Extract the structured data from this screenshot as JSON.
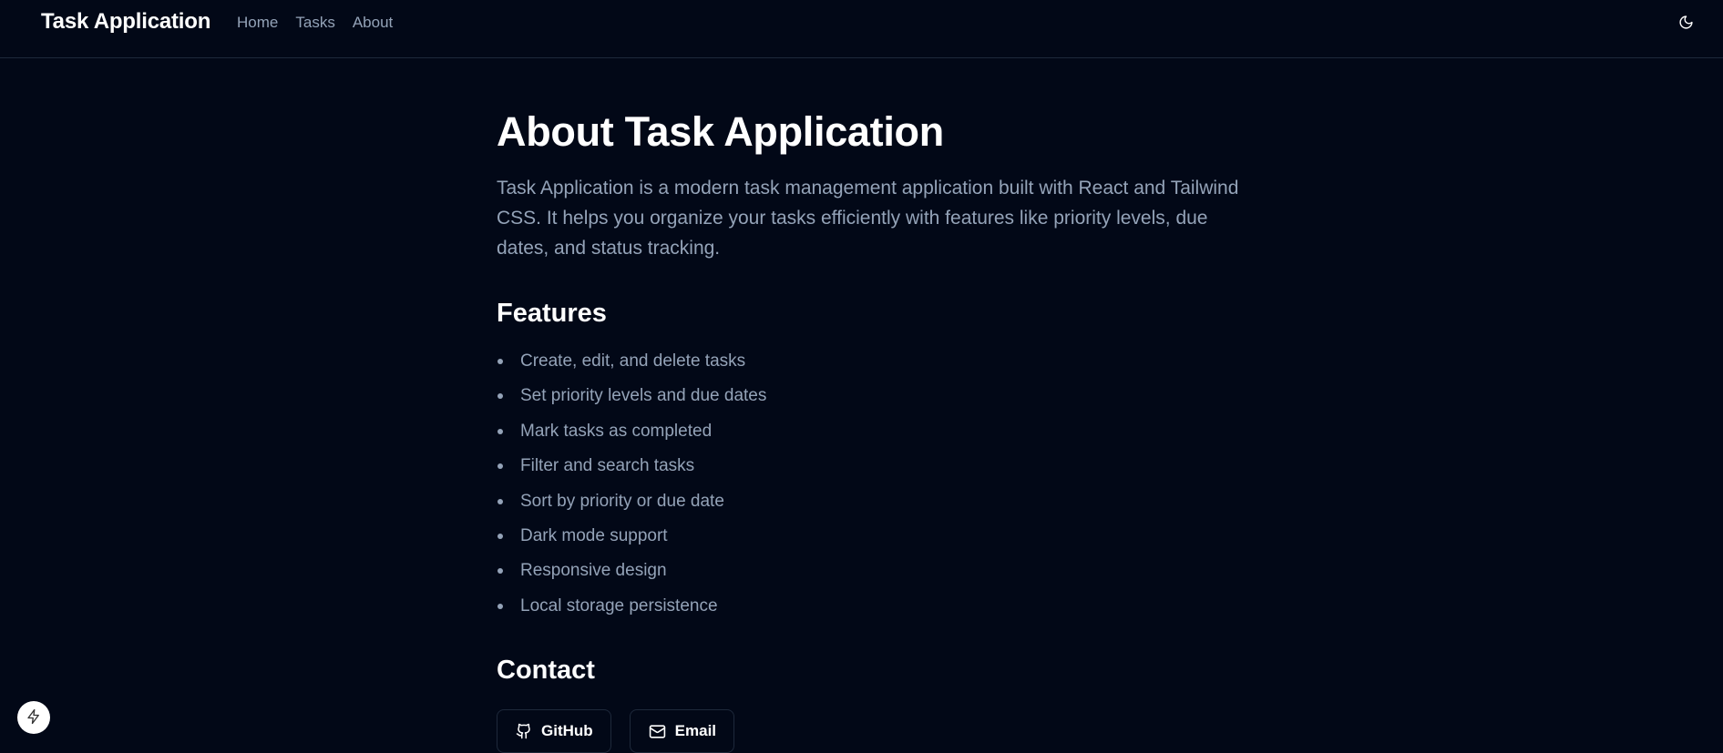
{
  "nav": {
    "brand": "Task Application",
    "links": [
      {
        "label": "Home"
      },
      {
        "label": "Tasks"
      },
      {
        "label": "About"
      }
    ],
    "theme_icon": "moon-icon"
  },
  "about": {
    "title": "About Task Application",
    "intro": "Task Application is a modern task management application built with React and Tailwind CSS. It helps you organize your tasks efficiently with features like priority levels, due dates, and status tracking.",
    "features_heading": "Features",
    "features": [
      "Create, edit, and delete tasks",
      "Set priority levels and due dates",
      "Mark tasks as completed",
      "Filter and search tasks",
      "Sort by priority or due date",
      "Dark mode support",
      "Responsive design",
      "Local storage persistence"
    ],
    "contact_heading": "Contact",
    "contact_buttons": [
      {
        "label": "GitHub",
        "icon": "github-icon"
      },
      {
        "label": "Email",
        "icon": "mail-icon"
      }
    ]
  },
  "floating": {
    "icon": "lightning-icon"
  },
  "colors": {
    "background": "#020817",
    "border": "#1e293b",
    "muted_text": "#94a3b8",
    "heading_text": "#ffffff"
  }
}
